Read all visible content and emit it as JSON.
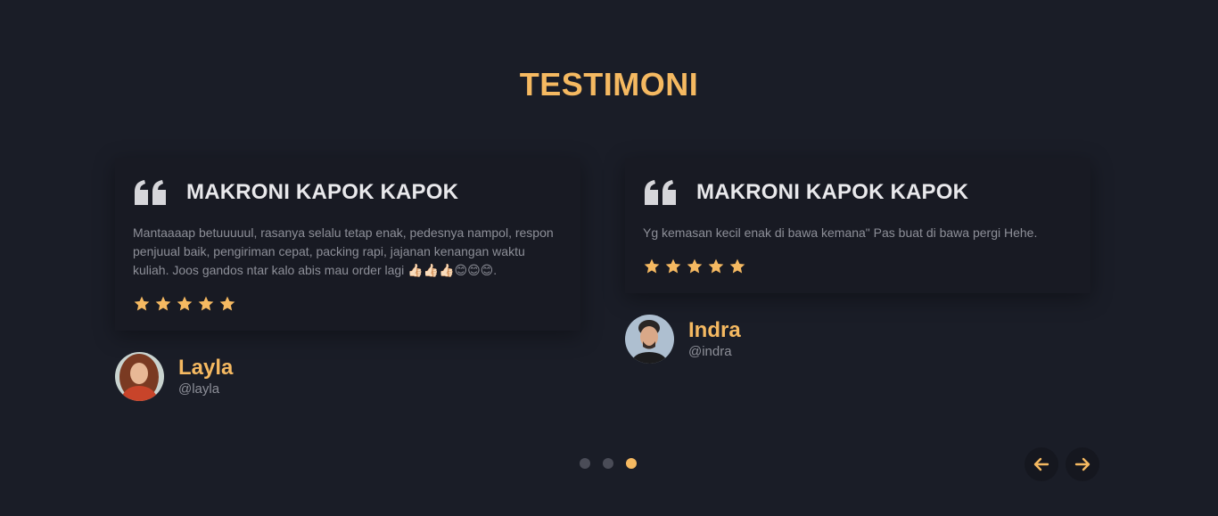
{
  "section": {
    "title": "TESTIMONI"
  },
  "testimonials": [
    {
      "title": "MAKRONI KAPOK KAPOK",
      "text": "Mantaaaap betuuuuul, rasanya selalu tetap enak, pedesnya nampol, respon penjuual baik, pengiriman cepat, packing rapi, jajanan kenangan waktu kuliah. Joos gandos ntar kalo abis mau order lagi 👍🏻👍🏻👍🏻😊😊😊.",
      "rating": 5,
      "author": {
        "name": "Layla",
        "handle": "@layla"
      }
    },
    {
      "title": "MAKRONI KAPOK KAPOK",
      "text": "Yg kemasan kecil enak di bawa kemana\" Pas buat di bawa pergi Hehe.",
      "rating": 5,
      "author": {
        "name": "Indra",
        "handle": "@indra"
      }
    }
  ],
  "pagination": {
    "total": 3,
    "active": 3
  },
  "colors": {
    "accent": "#f5b961",
    "background": "#1a1d27",
    "card": "#181a23",
    "muted_text": "#8d8f98"
  },
  "icons": {
    "quote": "quote-icon",
    "star": "star-icon",
    "prev": "arrow-left-icon",
    "next": "arrow-right-icon"
  }
}
